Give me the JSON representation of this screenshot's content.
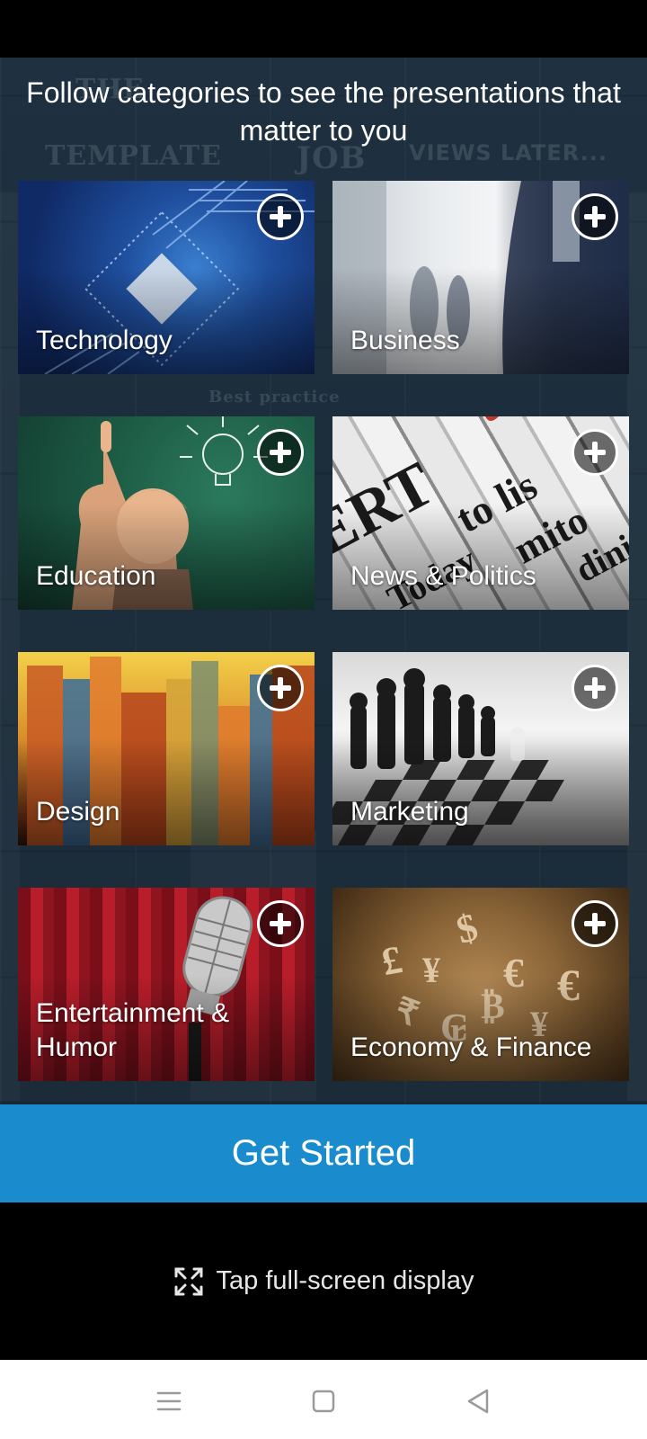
{
  "headline": "Follow categories to see the presentations that matter to you",
  "categories": [
    {
      "label": "Technology",
      "icon": "plus-icon"
    },
    {
      "label": "Business",
      "icon": "plus-icon"
    },
    {
      "label": "Education",
      "icon": "plus-icon"
    },
    {
      "label": "News & Politics",
      "icon": "plus-icon"
    },
    {
      "label": "Design",
      "icon": "plus-icon"
    },
    {
      "label": "Marketing",
      "icon": "plus-icon"
    },
    {
      "label": "Entertainment & Humor",
      "icon": "plus-icon"
    },
    {
      "label": "Economy & Finance",
      "icon": "plus-icon"
    }
  ],
  "cta": {
    "label": "Get Started"
  },
  "fullscreen": {
    "label": "Tap full-screen display",
    "icon": "expand-icon"
  },
  "nav": {
    "icons": [
      "menu-icon",
      "home-square-icon",
      "back-triangle-icon"
    ]
  },
  "colors": {
    "cta": "#1a8ccd",
    "background": "#1c2e3c"
  }
}
